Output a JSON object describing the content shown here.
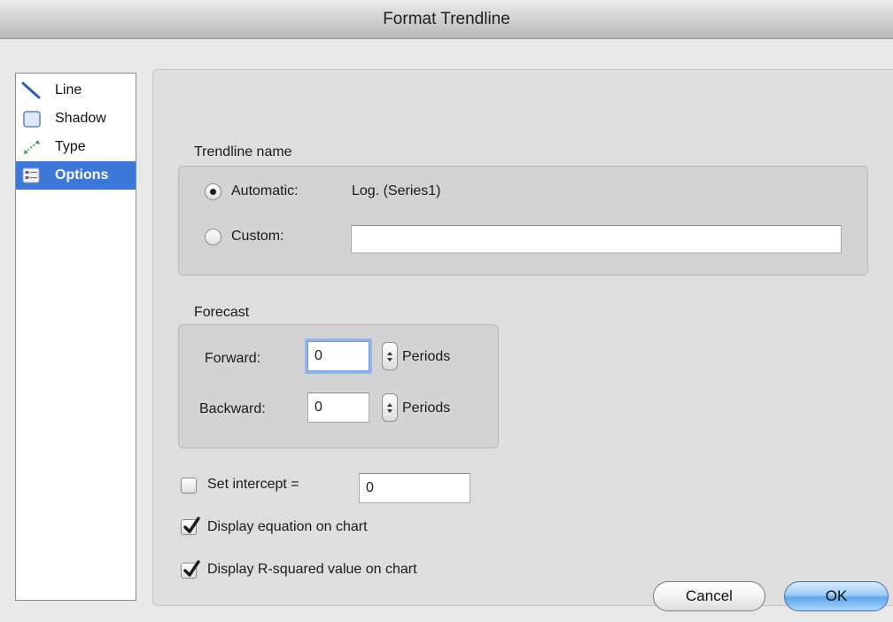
{
  "window": {
    "title": "Format Trendline"
  },
  "sidebar": {
    "items": [
      {
        "label": "Line",
        "icon": "line-icon",
        "selected": false
      },
      {
        "label": "Shadow",
        "icon": "shadow-icon",
        "selected": false
      },
      {
        "label": "Type",
        "icon": "type-icon",
        "selected": false
      },
      {
        "label": "Options",
        "icon": "options-icon",
        "selected": true
      }
    ]
  },
  "trendline_name": {
    "title": "Trendline name",
    "automatic_label": "Automatic:",
    "automatic_value": "Log. (Series1)",
    "automatic_selected": true,
    "custom_label": "Custom:",
    "custom_value": ""
  },
  "forecast": {
    "title": "Forecast",
    "forward_label": "Forward:",
    "forward_value": "0",
    "forward_unit": "Periods",
    "backward_label": "Backward:",
    "backward_value": "0",
    "backward_unit": "Periods"
  },
  "options": {
    "set_intercept_label": "Set intercept =",
    "set_intercept_checked": false,
    "intercept_value": "0",
    "display_equation_label": "Display equation on chart",
    "display_equation_checked": true,
    "display_r_squared_label": "Display R-squared value on chart",
    "display_r_squared_checked": true
  },
  "buttons": {
    "cancel_label": "Cancel",
    "ok_label": "OK"
  },
  "colors": {
    "selection": "#3b78d8",
    "default_button": "#5ea6ea",
    "focus_ring": "#93b5e8"
  }
}
